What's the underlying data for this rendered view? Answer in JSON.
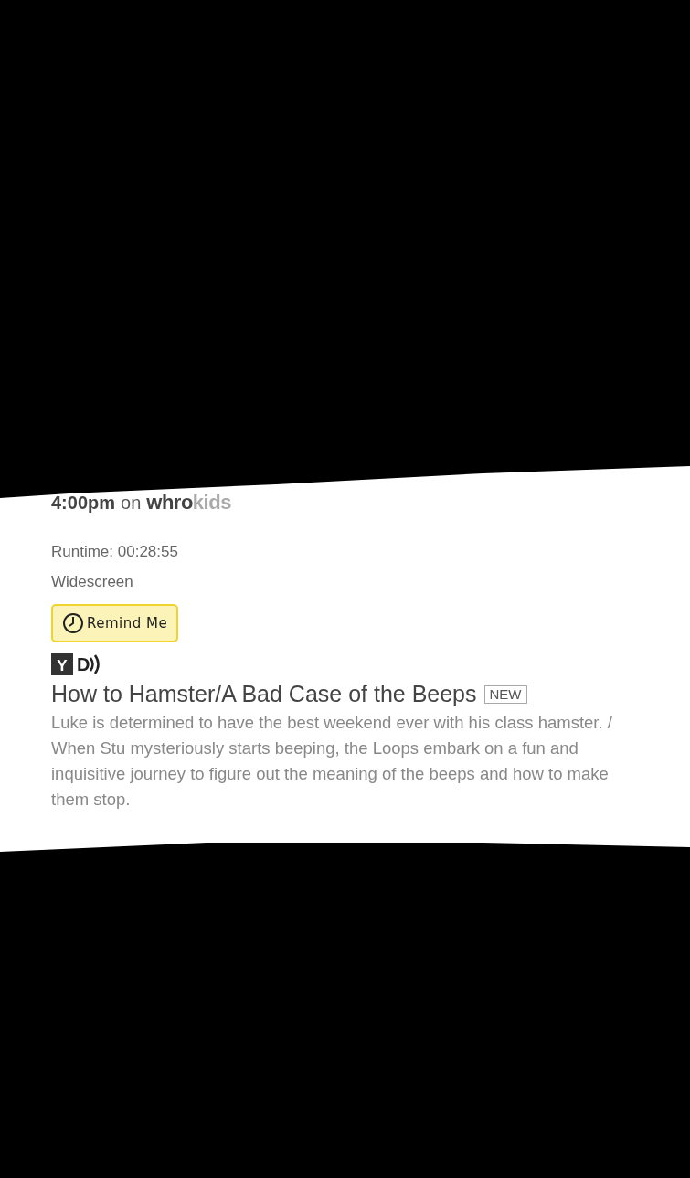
{
  "airing": {
    "time": "4:00pm",
    "connector": "on",
    "channel_logo": [
      "whro",
      "kids"
    ]
  },
  "details": [
    "Runtime: 00:28:55",
    "Widescreen"
  ],
  "remind_button": {
    "label": "Remind Me"
  },
  "ratings": [
    {
      "kind": "tv",
      "label": "Y"
    },
    {
      "kind": "descriptor",
      "label": "D"
    }
  ],
  "episode": {
    "title": "How to Hamster/A Bad Case of the Beeps",
    "badge": "NEW",
    "description": "Luke is determined to have the best weekend ever with his class hamster. / When Stu mysteriously starts beeping, the Loops embark on a fun and inquisitive journey to figure out the meaning of the beeps and how to make them stop."
  }
}
